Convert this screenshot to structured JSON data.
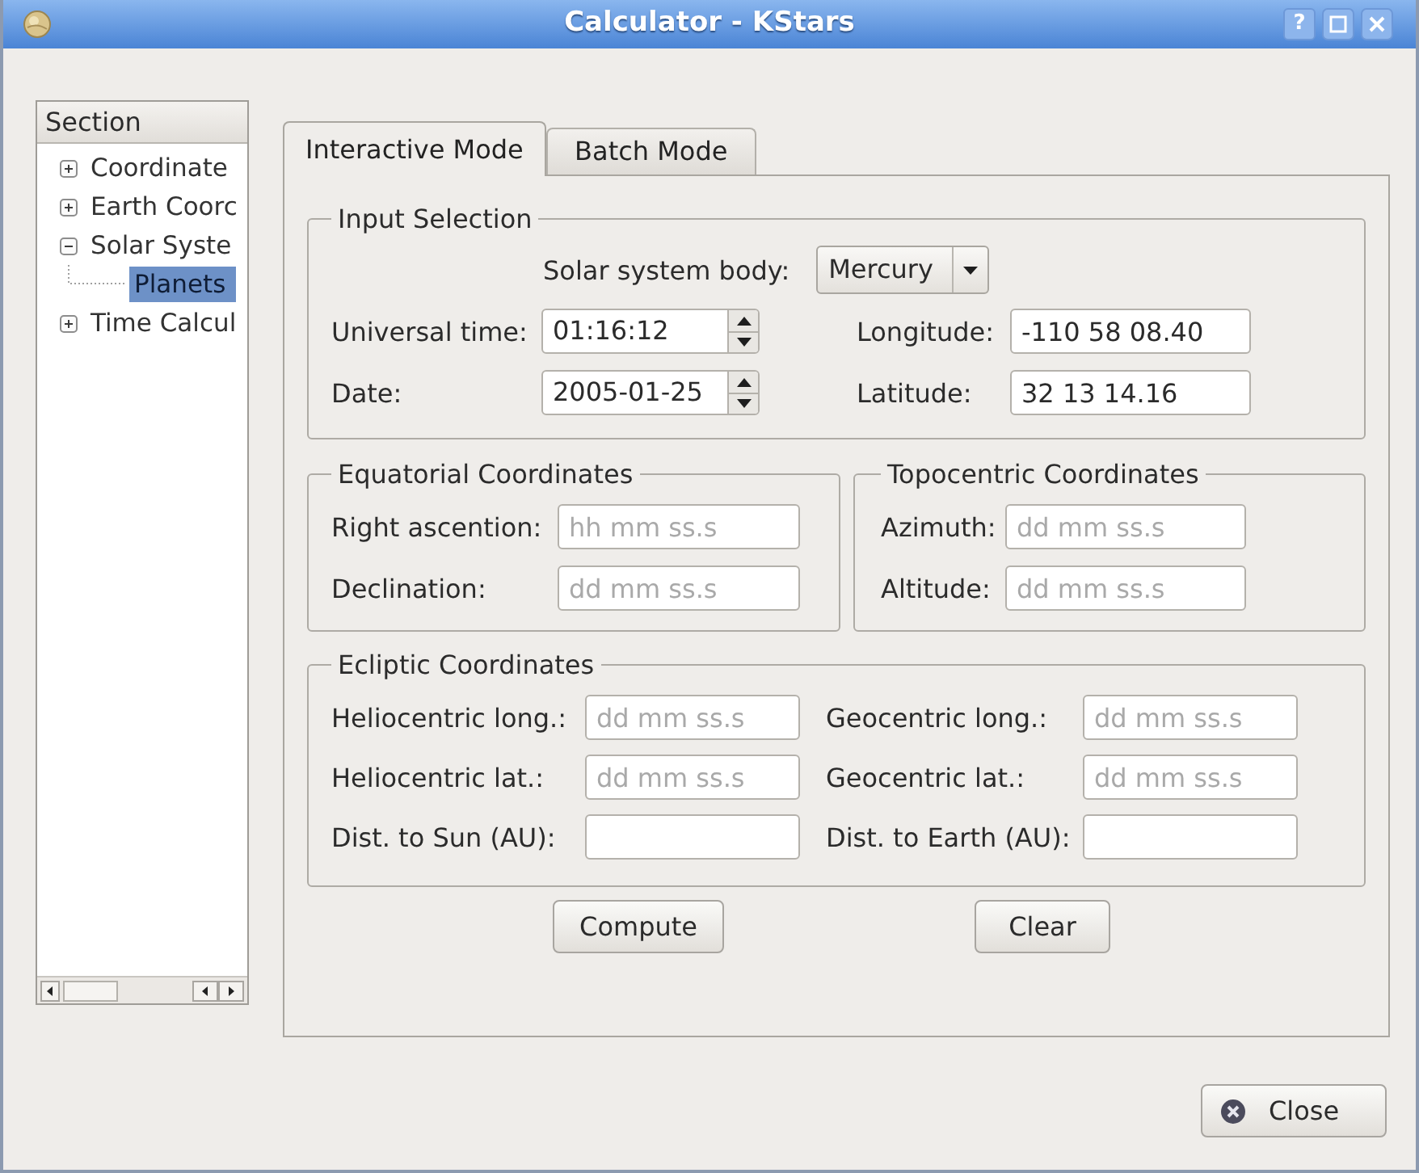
{
  "window": {
    "title": "Calculator - KStars",
    "help_button": "?"
  },
  "sidebar": {
    "header": "Section",
    "items": [
      {
        "label": "Coordinate",
        "selected": false,
        "expanded": false
      },
      {
        "label": "Earth Coorc",
        "selected": false,
        "expanded": false
      },
      {
        "label": "Solar Syste",
        "selected": false,
        "expanded": true,
        "children": [
          {
            "label": "Planets",
            "selected": true
          }
        ]
      },
      {
        "label": "Time Calcul",
        "selected": false,
        "expanded": false
      }
    ]
  },
  "tabs": [
    {
      "label": "Interactive Mode",
      "selected": true
    },
    {
      "label": "Batch Mode",
      "selected": false
    }
  ],
  "input_selection": {
    "title": "Input Selection",
    "body": {
      "label": "Solar system body:",
      "value": "Mercury"
    },
    "fields": [
      {
        "kind": "spin",
        "label": "Universal time:",
        "value": "01:16:12"
      },
      {
        "kind": "text",
        "label": "Longitude:",
        "value": "-110 58 08.40"
      },
      {
        "kind": "spin",
        "label": "Date:",
        "value": "2005-01-25"
      },
      {
        "kind": "text",
        "label": "Latitude:",
        "value": "32 13 14.16"
      }
    ]
  },
  "equatorial": {
    "title": "Equatorial Coordinates",
    "fields": [
      {
        "label": "Right ascention:",
        "placeholder": "hh mm ss.s"
      },
      {
        "label": "Declination:",
        "placeholder": "dd mm ss.s"
      }
    ]
  },
  "topocentric": {
    "title": "Topocentric Coordinates",
    "fields": [
      {
        "label": "Azimuth:",
        "placeholder": "dd mm ss.s"
      },
      {
        "label": "Altitude:",
        "placeholder": "dd mm ss.s"
      }
    ]
  },
  "ecliptic": {
    "title": "Ecliptic Coordinates",
    "fields": [
      {
        "label": "Heliocentric long.:",
        "placeholder": "dd mm ss.s"
      },
      {
        "label": "Geocentric long.:",
        "placeholder": "dd mm ss.s"
      },
      {
        "label": "Heliocentric lat.:",
        "placeholder": "dd mm ss.s"
      },
      {
        "label": "Geocentric lat.:",
        "placeholder": "dd mm ss.s"
      },
      {
        "label": "Dist. to Sun (AU):"
      },
      {
        "label": "Dist. to Earth (AU):"
      }
    ]
  },
  "buttons": [
    "Compute",
    "Clear"
  ],
  "close_button": "Close"
}
